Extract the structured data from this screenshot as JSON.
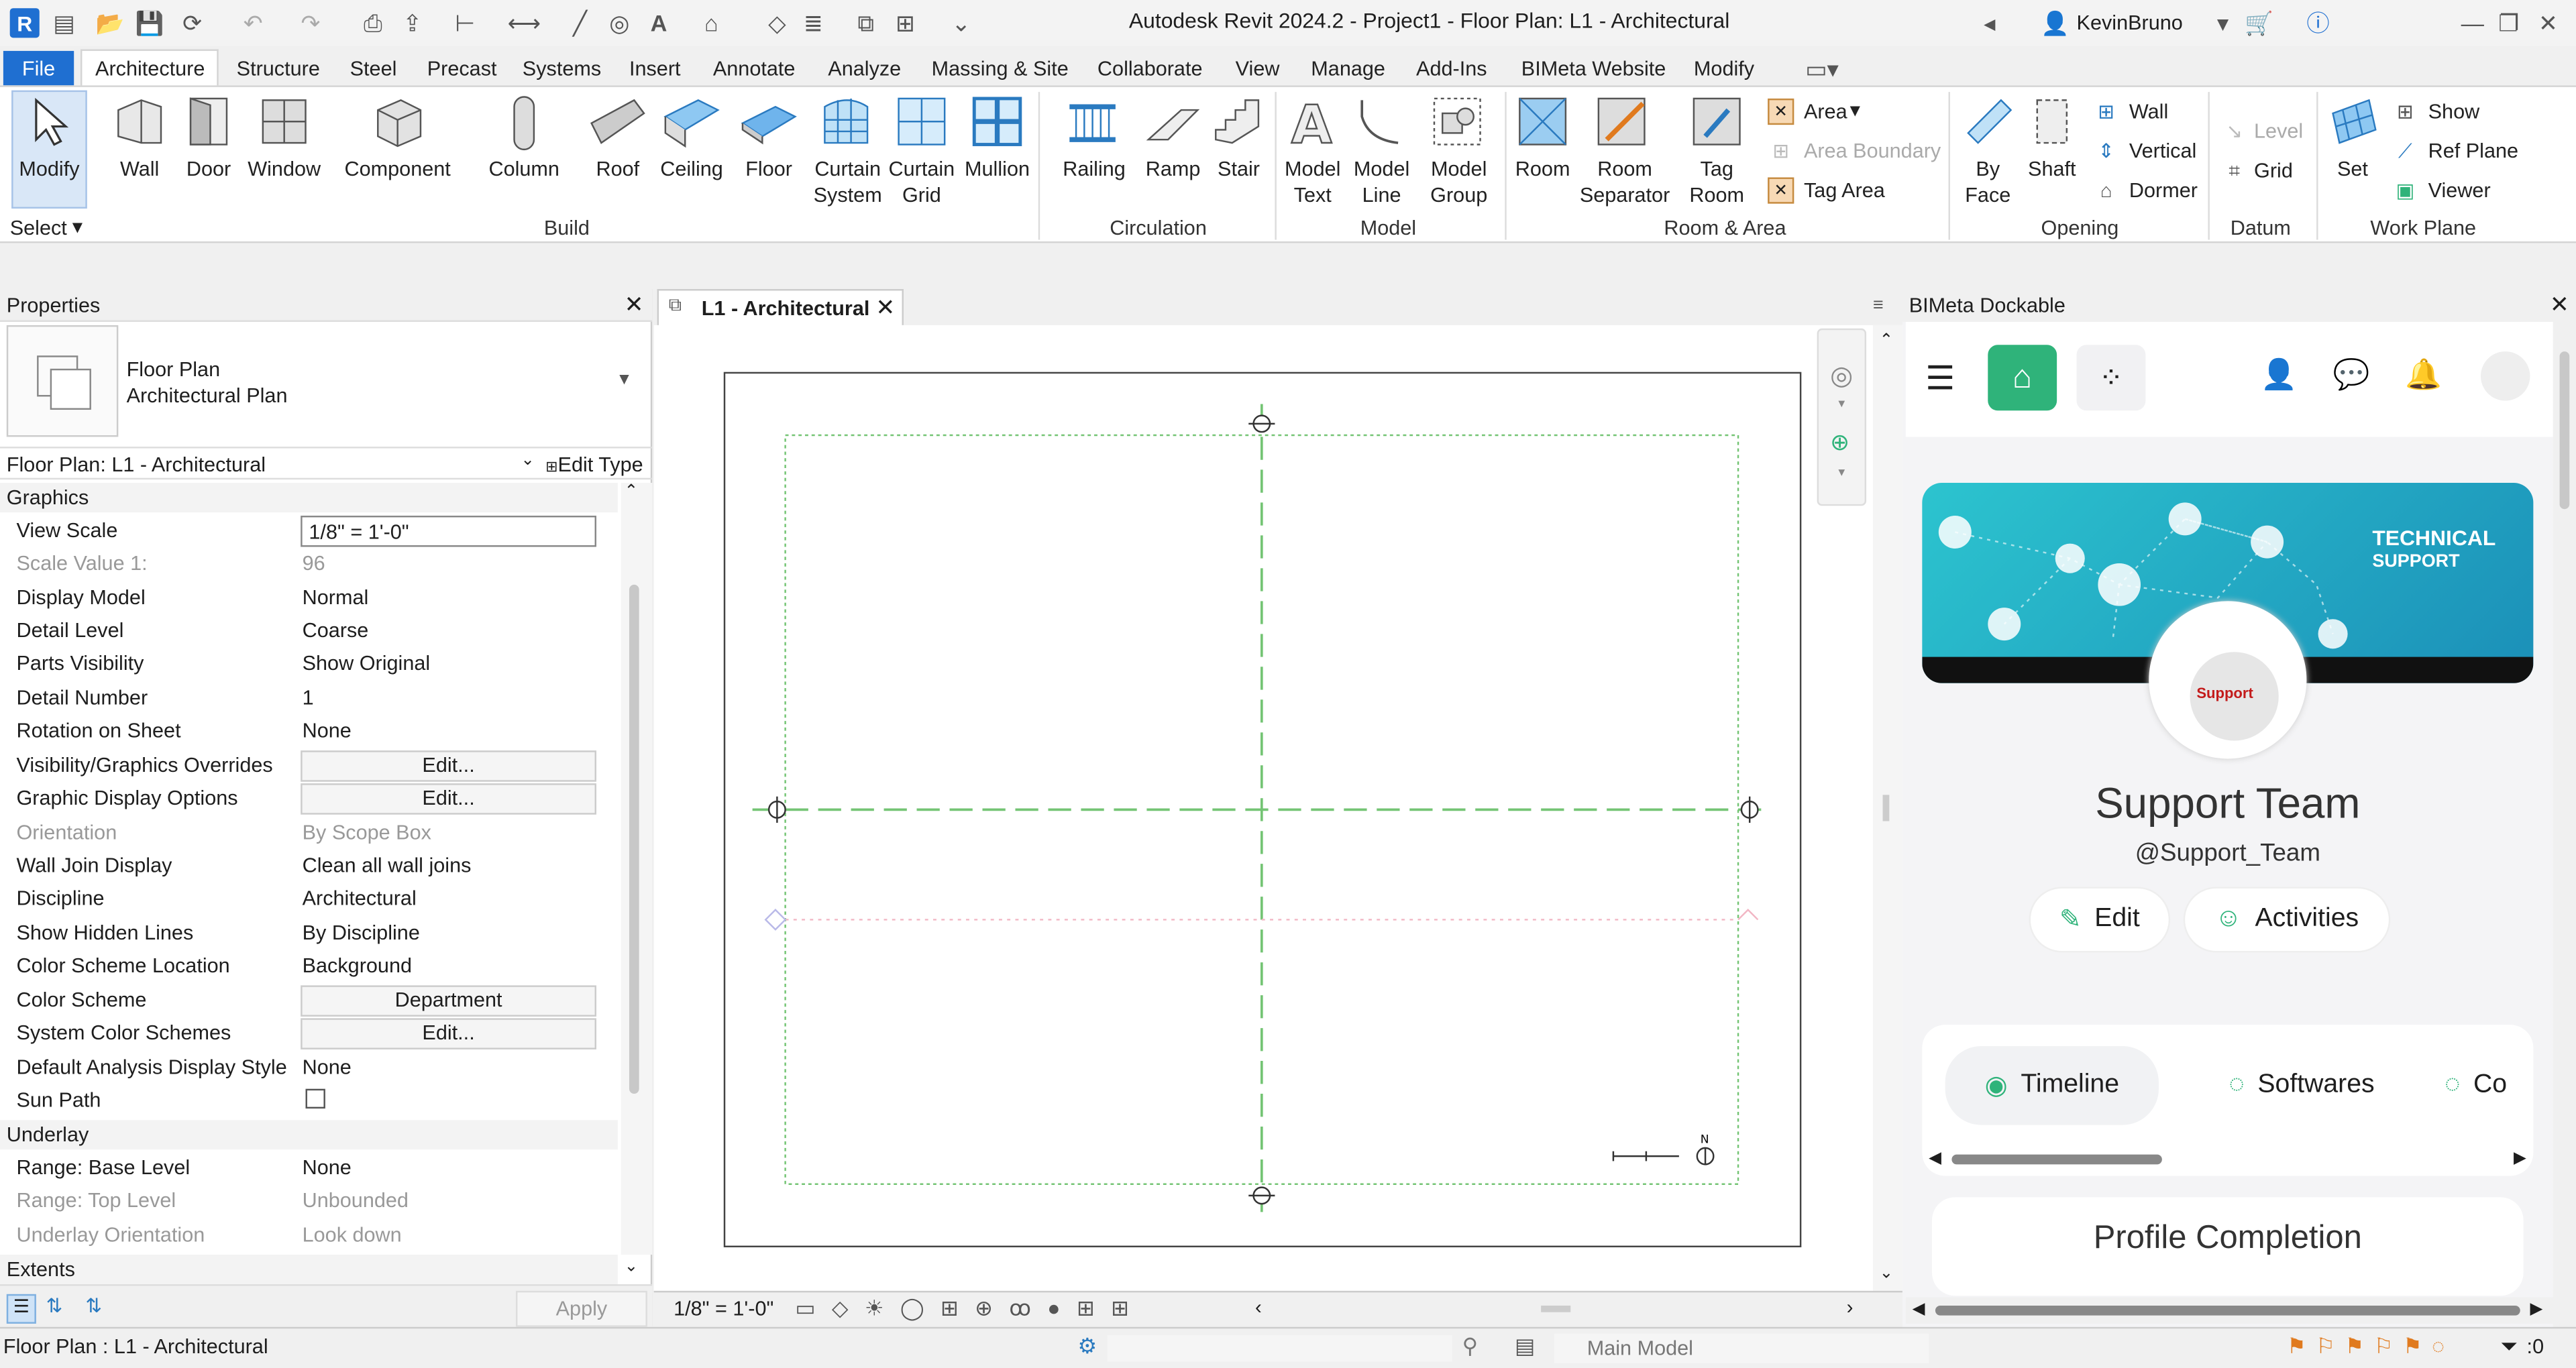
{
  "app": {
    "title": "Autodesk Revit 2024.2 - Project1 - Floor Plan: L1 - Architectural",
    "user": "KevinBruno"
  },
  "ribbon_tabs": [
    "File",
    "Architecture",
    "Structure",
    "Steel",
    "Precast",
    "Systems",
    "Insert",
    "Annotate",
    "Analyze",
    "Massing & Site",
    "Collaborate",
    "View",
    "Manage",
    "Add-Ins",
    "BIMeta Website",
    "Modify"
  ],
  "ribbon": {
    "select": {
      "modify": "Modify",
      "select": "Select"
    },
    "build": {
      "wall": "Wall",
      "door": "Door",
      "window": "Window",
      "component": "Component",
      "column": "Column",
      "roof": "Roof",
      "ceiling": "Ceiling",
      "floor": "Floor",
      "curtain_system": [
        "Curtain",
        "System"
      ],
      "curtain_grid": [
        "Curtain",
        "Grid"
      ],
      "mullion": "Mullion",
      "panel": "Build"
    },
    "circulation": {
      "railing": "Railing",
      "ramp": "Ramp",
      "stair": "Stair",
      "panel": "Circulation"
    },
    "model": {
      "model_text": [
        "Model",
        "Text"
      ],
      "model_line": [
        "Model",
        "Line"
      ],
      "model_group": [
        "Model",
        "Group"
      ],
      "panel": "Model"
    },
    "room_area": {
      "room": "Room",
      "room_separator": [
        "Room",
        "Separator"
      ],
      "tag_room": [
        "Tag",
        "Room"
      ],
      "area": "Area",
      "area_boundary": "Area  Boundary",
      "tag_area": "Tag  Area",
      "panel": "Room & Area"
    },
    "opening": {
      "by_face": [
        "By",
        "Face"
      ],
      "shaft": "Shaft",
      "wall": "Wall",
      "vertical": "Vertical",
      "dormer": "Dormer",
      "panel": "Opening"
    },
    "datum": {
      "level": "Level",
      "grid": "Grid",
      "panel": "Datum"
    },
    "work_plane": {
      "set": "Set",
      "show": "Show",
      "ref_plane": "Ref  Plane",
      "viewer": "Viewer",
      "panel": "Work Plane"
    }
  },
  "properties": {
    "title": "Properties",
    "type_name_1": "Floor Plan",
    "type_name_2": "Architectural Plan",
    "selector": "Floor Plan: L1 - Architectural",
    "edit_type": "Edit Type",
    "section_graphics": "Graphics",
    "rows": [
      {
        "label": "View Scale",
        "value": "1/8\" = 1'-0\""
      },
      {
        "label": "Scale Value    1:",
        "value": "96"
      },
      {
        "label": "Display Model",
        "value": "Normal"
      },
      {
        "label": "Detail Level",
        "value": "Coarse"
      },
      {
        "label": "Parts Visibility",
        "value": "Show Original"
      },
      {
        "label": "Detail Number",
        "value": "1"
      },
      {
        "label": "Rotation on Sheet",
        "value": "None"
      },
      {
        "label": "Visibility/Graphics Overrides",
        "value": "Edit..."
      },
      {
        "label": "Graphic Display Options",
        "value": "Edit..."
      },
      {
        "label": "Orientation",
        "value": "By Scope Box"
      },
      {
        "label": "Wall Join Display",
        "value": "Clean all wall joins"
      },
      {
        "label": "Discipline",
        "value": "Architectural"
      },
      {
        "label": "Show Hidden Lines",
        "value": "By Discipline"
      },
      {
        "label": "Color Scheme Location",
        "value": "Background"
      },
      {
        "label": "Color Scheme",
        "value": "Department"
      },
      {
        "label": "System Color Schemes",
        "value": "Edit..."
      },
      {
        "label": "Default Analysis Display Style",
        "value": "None"
      },
      {
        "label": "Sun Path",
        "value": ""
      }
    ],
    "section_underlay": "Underlay",
    "underlay_rows": [
      {
        "label": "Range: Base Level",
        "value": "None"
      },
      {
        "label": "Range: Top Level",
        "value": "Unbounded"
      },
      {
        "label": "Underlay Orientation",
        "value": "Look down"
      }
    ],
    "section_extents": "Extents",
    "apply": "Apply"
  },
  "view": {
    "tab": "L1 - Architectural",
    "scale": "1/8\" = 1'-0\""
  },
  "bimeta": {
    "title": "BIMeta Dockable",
    "banner_title": "TECHNICAL",
    "banner_sub": "SUPPORT",
    "avatar_badge": "Support",
    "name": "Support Team",
    "handle": "@Support_Team",
    "edit": "Edit",
    "activities": "Activities",
    "tabs": [
      "Timeline",
      "Softwares",
      "Co"
    ],
    "profile_completion": "Profile Completion",
    "accent": "#2fb37a"
  },
  "status": {
    "left": "Floor Plan : L1 - Architectural",
    "model": "Main Model",
    "filter_count": ":0"
  }
}
